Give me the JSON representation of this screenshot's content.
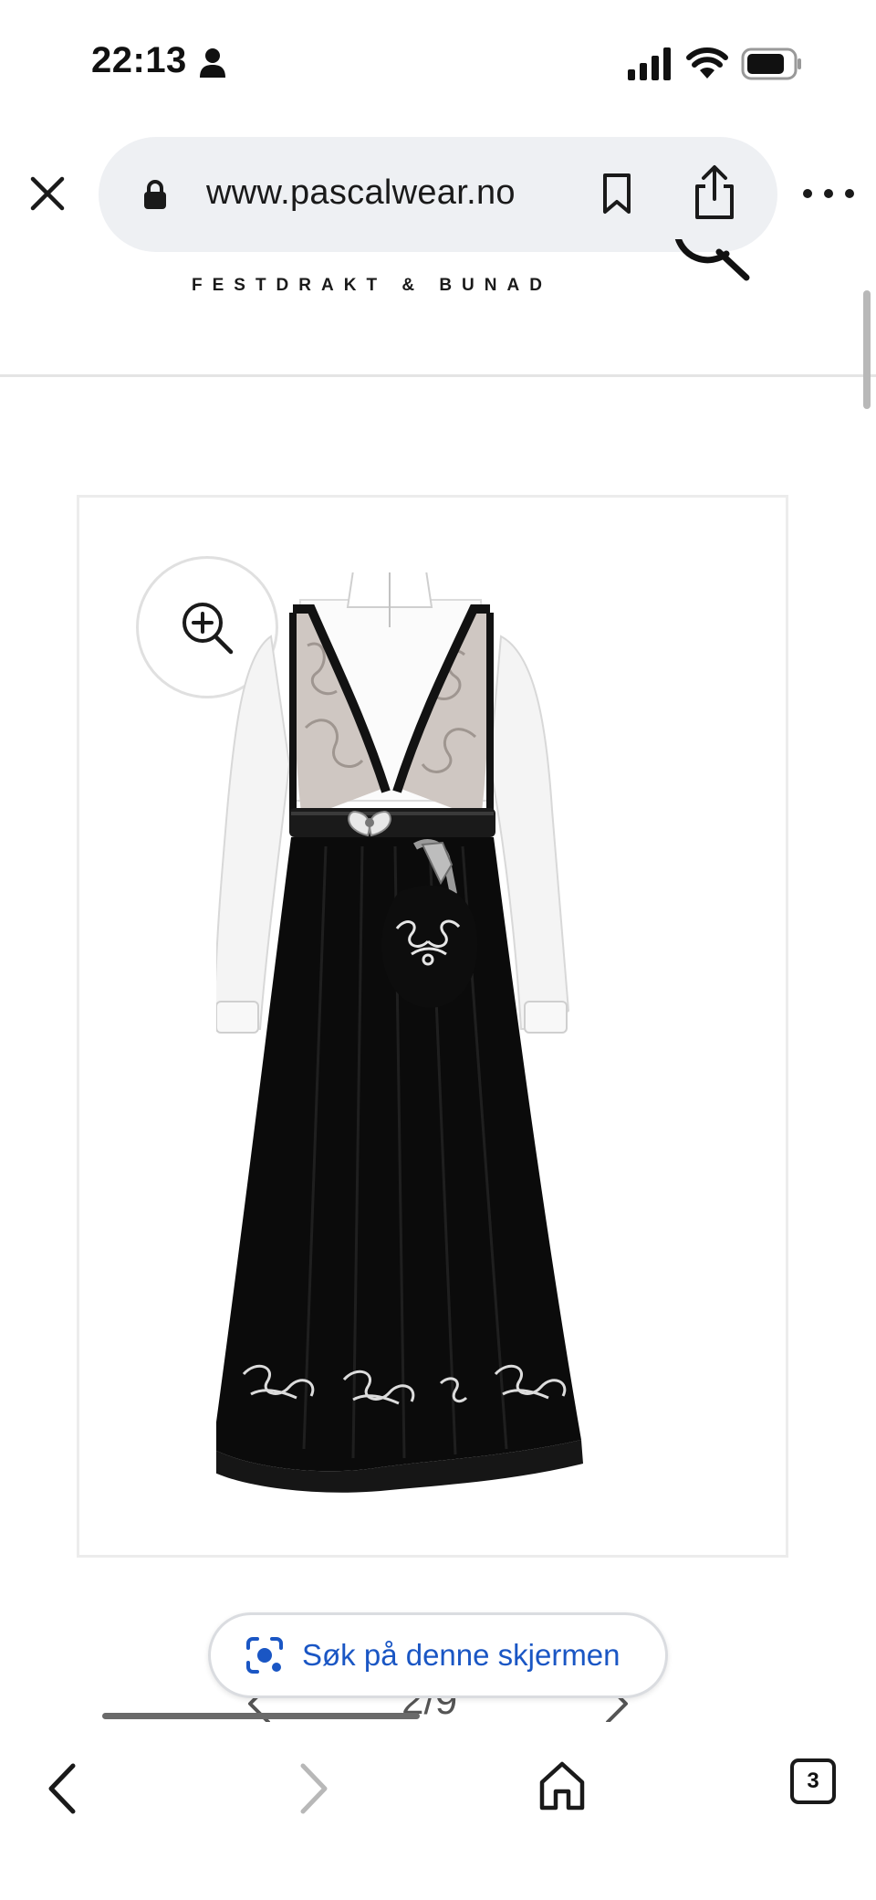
{
  "status_bar": {
    "time": "22:13",
    "icons": [
      "person-icon",
      "signal-icon",
      "wifi-icon",
      "battery-icon"
    ]
  },
  "browser": {
    "url": "www.pascalwear.no",
    "icons": [
      "close-icon",
      "lock-icon",
      "bookmark-icon",
      "share-icon",
      "more-icon"
    ]
  },
  "site": {
    "tagline": "FESTDRAKT & BUNAD",
    "icons": [
      "search-icon"
    ]
  },
  "product": {
    "image_subject": "bunad-image",
    "zoom_icon": "zoom-in-icon"
  },
  "carousel": {
    "counter": "2/9",
    "icons": [
      "chevron-left-icon",
      "chevron-right-icon"
    ]
  },
  "lens": {
    "label": "Søk på denne skjermen",
    "icon": "lens-icon",
    "color": "#1a56c4"
  },
  "bottom_nav": {
    "tab_count": "3",
    "icons": [
      "back-icon",
      "forward-icon",
      "home-icon",
      "tabs-icon"
    ]
  }
}
